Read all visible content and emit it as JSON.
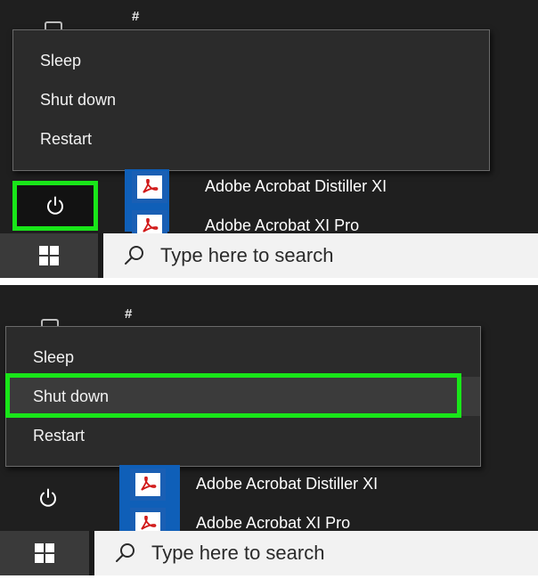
{
  "panels": [
    {
      "name": "panel-top",
      "menu": [
        "Sleep",
        "Shut down",
        "Restart"
      ],
      "highlighted_item": "power-button",
      "apps": [
        "Adobe Acrobat Distiller XI",
        "Adobe Acrobat XI Pro"
      ],
      "section_letter": "#"
    },
    {
      "name": "panel-bottom",
      "menu": [
        "Sleep",
        "Shut down",
        "Restart"
      ],
      "highlighted_item": "Shut down",
      "apps": [
        "Adobe Acrobat Distiller XI",
        "Adobe Acrobat XI Pro"
      ],
      "section_letter": "#"
    }
  ],
  "taskbar": {
    "search_placeholder": "Type here to search",
    "start_icon": "windows-logo-icon",
    "search_icon": "search-icon"
  },
  "icons": {
    "power": "power-icon",
    "app": "acrobat-pdf-icon"
  },
  "colors": {
    "highlight": "#19e619",
    "menu_bg": "#2b2b2b",
    "start_bg": "#1f1f1f",
    "tile_blue": "#1a5fb4"
  }
}
